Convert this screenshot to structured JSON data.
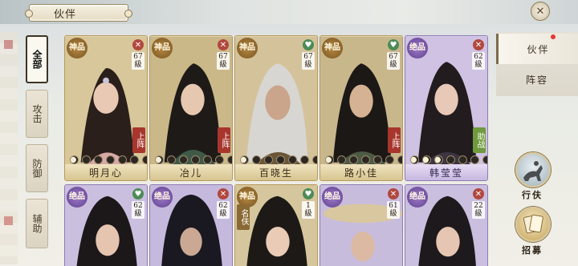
{
  "header": {
    "title": "伙伴"
  },
  "left_tabs": [
    {
      "label": "全部",
      "active": true
    },
    {
      "label": "攻击",
      "active": false
    },
    {
      "label": "防御",
      "active": false
    },
    {
      "label": "辅助",
      "active": false
    }
  ],
  "right_tabs": [
    {
      "label": "伙伴",
      "active": true
    },
    {
      "label": "阵容",
      "active": false
    }
  ],
  "actions": {
    "travel": "行伕",
    "recruit": "招募"
  },
  "colors": {
    "gold_frame": "#b79a5c",
    "purple_frame": "#8e7bb3",
    "status_red": "#a8362d",
    "status_green": "#6f9a3d"
  },
  "cards_row1": [
    {
      "name": "明月心",
      "rank": "神品",
      "level_num": "67",
      "level_unit": "級",
      "status": "上阵",
      "flag": "x"
    },
    {
      "name": "冶儿",
      "rank": "神品",
      "level_num": "67",
      "level_unit": "級",
      "status": "上阵",
      "flag": "x"
    },
    {
      "name": "百晓生",
      "rank": "神品",
      "level_num": "67",
      "level_unit": "級",
      "status": "",
      "flag": "h"
    },
    {
      "name": "路小佳",
      "rank": "神品",
      "level_num": "67",
      "level_unit": "級",
      "status": "上阵",
      "flag": "h"
    },
    {
      "name": "韩莹莹",
      "rank": "绝品",
      "level_num": "62",
      "level_unit": "級",
      "status": "助战",
      "flag": "x"
    }
  ],
  "cards_row2": [
    {
      "rank": "绝品",
      "level_num": "62",
      "level_unit": "級",
      "flag": "h"
    },
    {
      "rank": "绝品",
      "level_num": "62",
      "level_unit": "級",
      "flag": "x"
    },
    {
      "rank": "神品",
      "level_num": "1",
      "level_unit": "級",
      "flag": "h",
      "tag": "名伕"
    },
    {
      "rank": "绝品",
      "level_num": "61",
      "level_unit": "級",
      "flag": "x"
    },
    {
      "rank": "绝品",
      "level_num": "22",
      "level_unit": "級",
      "flag": "x"
    }
  ]
}
